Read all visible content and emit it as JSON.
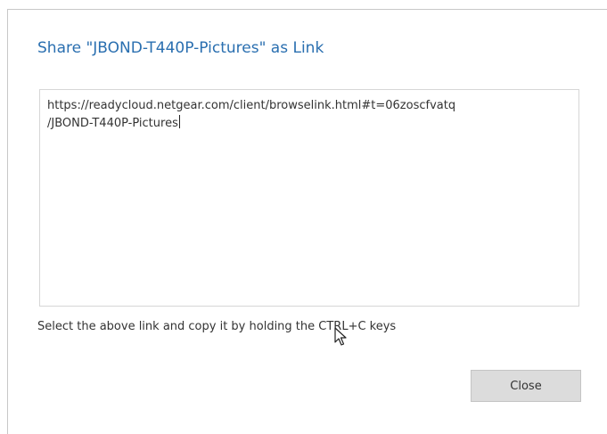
{
  "dialog": {
    "title": "Share \"JBOND-T440P-Pictures\" as Link",
    "link_line1": "https://readycloud.netgear.com/client/browselink.html#t=06zoscfvatq",
    "link_line2": "/JBOND-T440P-Pictures",
    "hint": "Select the above link and copy it by holding the CTRL+C keys",
    "close_label": "Close"
  },
  "colors": {
    "title": "#2a6fb0",
    "button_bg": "#dcdcdc",
    "border": "#d6d6d6"
  },
  "icons": {
    "cursor": "mouse-pointer-icon"
  }
}
